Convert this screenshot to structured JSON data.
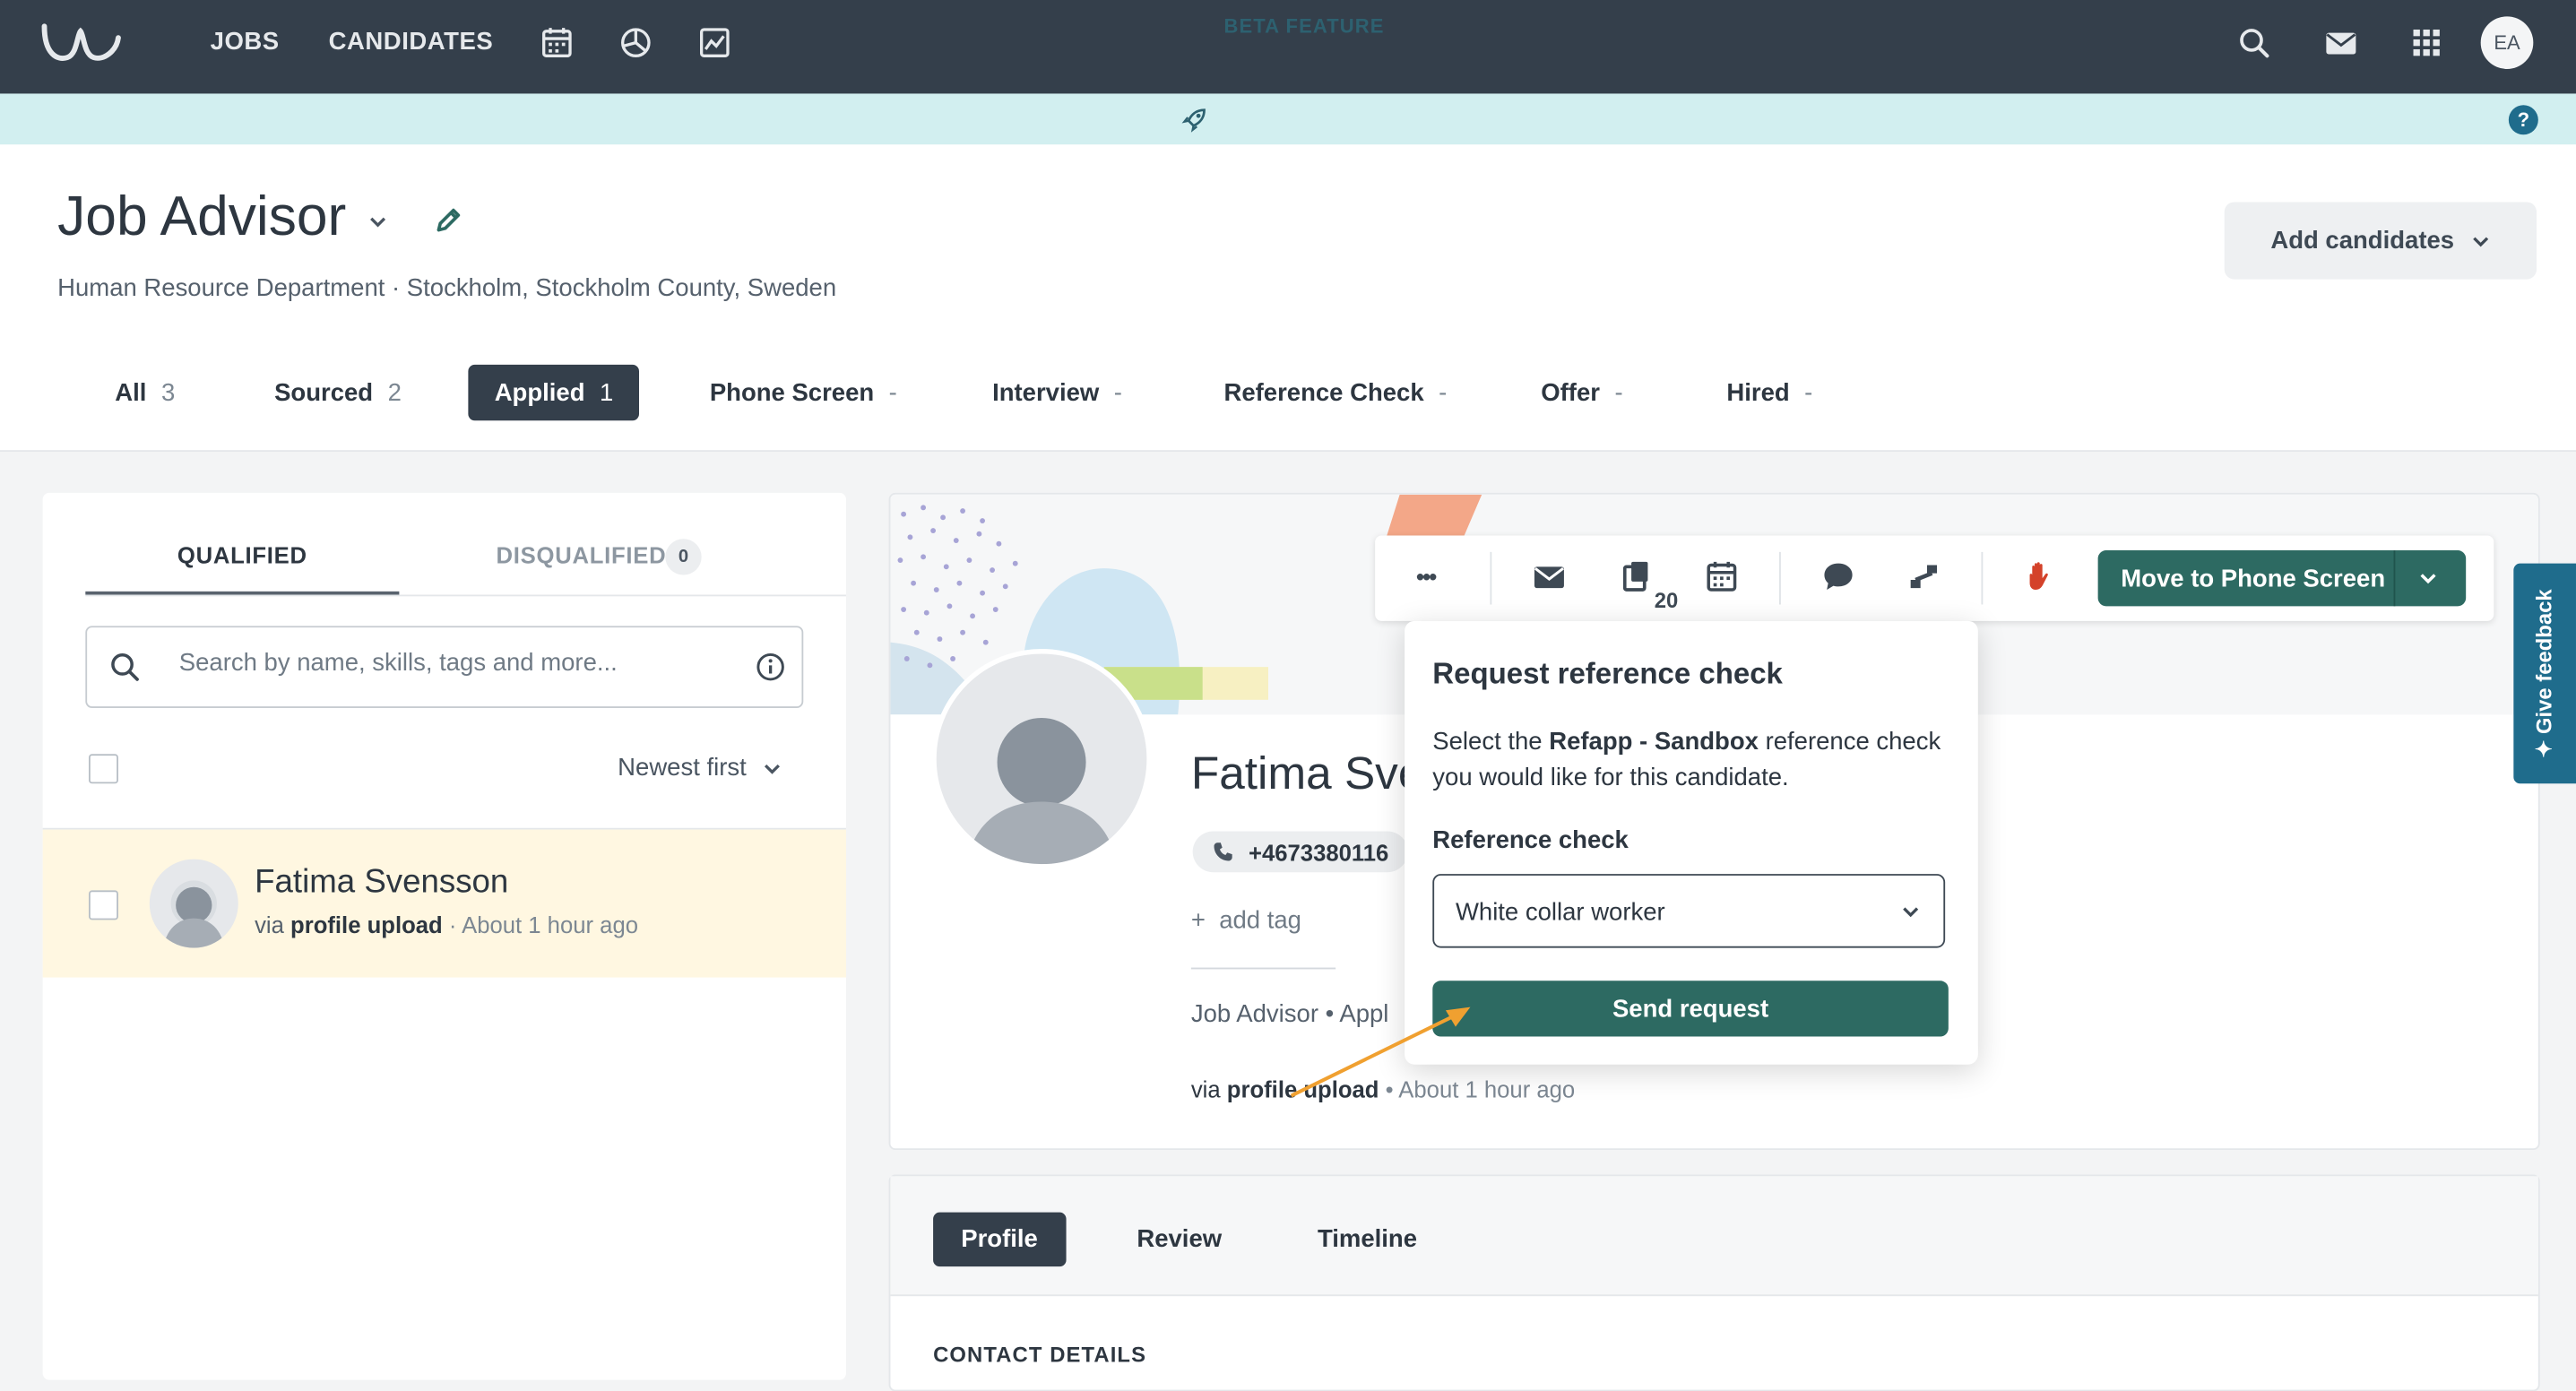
{
  "nav": {
    "jobs": "JOBS",
    "candidates": "CANDIDATES",
    "icons": [
      "calendar-icon",
      "pie-chart-icon",
      "report-icon",
      "search-icon",
      "mail-icon",
      "apps-grid-icon"
    ],
    "avatar_initials": "EA",
    "bg_color": "#343f4b"
  },
  "beta": {
    "label": "BETA FEATURE",
    "help": "?"
  },
  "job": {
    "title": "Job Advisor",
    "subtitle": "Human Resource Department · Stockholm, Stockholm County, Sweden",
    "add_candidates": "Add candidates"
  },
  "stages": [
    {
      "label": "All",
      "count": "3"
    },
    {
      "label": "Sourced",
      "count": "2"
    },
    {
      "label": "Applied",
      "count": "1",
      "active": true
    },
    {
      "label": "Phone Screen",
      "count": "-"
    },
    {
      "label": "Interview",
      "count": "-"
    },
    {
      "label": "Reference Check",
      "count": "-"
    },
    {
      "label": "Offer",
      "count": "-"
    },
    {
      "label": "Hired",
      "count": "-"
    }
  ],
  "list": {
    "tab_qualified": "QUALIFIED",
    "tab_disqualified": "DISQUALIFIED",
    "disqualified_count": "0",
    "search_placeholder": "Search by name, skills, tags and more...",
    "sort_label": "Newest first"
  },
  "candidate": {
    "name": "Fatima Svensson",
    "name_truncated": "Fatima Sve",
    "via_prefix": "via",
    "via_source": "profile upload",
    "time": "· About 1 hour ago",
    "time_bullet": "• About 1 hour ago",
    "phone": "+4673380116",
    "add_tag": "add tag",
    "job_applied": "Job Advisor • Appl"
  },
  "toolbar": {
    "more": "•••",
    "count": "20",
    "move_label": "Move to Phone Screen",
    "accent": "#2d6a62"
  },
  "popover": {
    "title": "Request reference check",
    "desc_prefix": "Select the",
    "desc_bold": "Refapp - Sandbox",
    "desc_suffix": "reference check you would like for this candidate.",
    "field_label": "Reference check",
    "selected": "White collar worker",
    "send": "Send request"
  },
  "feedback": "✦ Give feedback",
  "profile_tabs": [
    "Profile",
    "Review",
    "Timeline"
  ],
  "contact_heading": "CONTACT DETAILS"
}
